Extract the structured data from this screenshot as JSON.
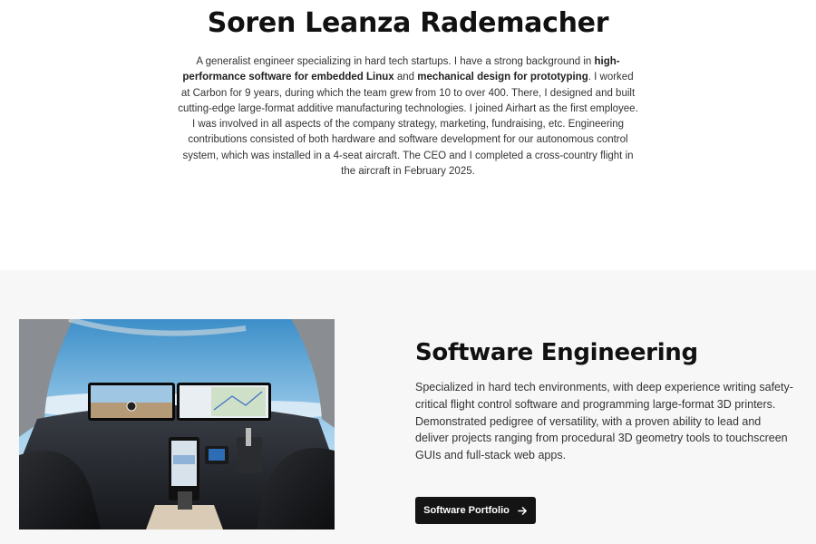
{
  "hero": {
    "name": "Soren Leanza Rademacher",
    "bio": {
      "t1": "A generalist engineer specializing in hard tech startups. I have a strong background in ",
      "b1": "high-performance software for embedded Linux",
      "t2": " and ",
      "b2": "mechanical design for prototyping",
      "t3": ". I worked at Carbon for 9 years, during which the team grew from 10 to over 400. There, I designed and built cutting-edge large-format additive manufacturing technologies. I joined Airhart as the first employee. I was involved in all aspects of the company strategy, marketing, fundraising, etc. Engineering contributions consisted of both hardware and software development for our autonomous control system, which was installed in a 4-seat aircraft. The CEO and I completed a cross-country flight in the aircraft in February 2025."
    }
  },
  "feature": {
    "title": "Software Engineering",
    "description": "Specialized in hard tech environments, with deep experience writing safety-critical flight control software and programming large-format 3D printers. Demonstrated pedigree of versatility, with a proven ability to lead and deliver projects ranging from procedural 3D geometry tools to touchscreen GUIs and full-stack web apps.",
    "button_label": "Software Portfolio",
    "button_icon": "arrow-right-icon",
    "image_subject": "aircraft-cockpit-photo"
  }
}
